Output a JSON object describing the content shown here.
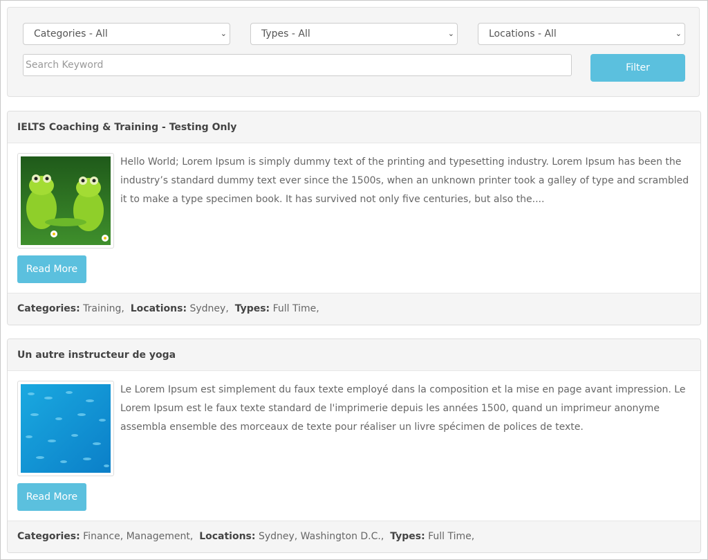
{
  "filters": {
    "categories": "Categories - All",
    "types": "Types - All",
    "locations": "Locations - All",
    "search_placeholder": "Search Keyword",
    "filter_label": "Filter"
  },
  "listings": [
    {
      "title": "IELTS Coaching & Training - Testing Only",
      "description": "Hello World; Lorem Ipsum is simply dummy text of the printing and typesetting industry. Lorem Ipsum has been the industry’s standard dummy text ever since the 1500s, when an unknown printer took a galley of type and scrambled it to make a type specimen book. It has survived not only five centuries, but also the....",
      "read_more": "Read More",
      "categories_label": "Categories:",
      "categories": "Training,",
      "locations_label": "Locations:",
      "locations": "Sydney,",
      "types_label": "Types:",
      "types": "Full Time,"
    },
    {
      "title": "Un autre instructeur de yoga",
      "description": "Le Lorem Ipsum est simplement du faux texte employé dans la composition et la mise en page avant impression. Le Lorem Ipsum est le faux texte standard de l'imprimerie depuis les années 1500, quand un imprimeur anonyme assembla ensemble des morceaux de texte pour réaliser un livre spécimen de polices de texte.",
      "read_more": "Read More",
      "categories_label": "Categories:",
      "categories": "Finance, Management,",
      "locations_label": "Locations:",
      "locations": "Sydney, Washington D.C.,",
      "types_label": "Types:",
      "types": "Full Time,"
    }
  ],
  "colors": {
    "accent": "#5bc0de",
    "panel": "#f5f5f5",
    "border": "#dddddd"
  }
}
